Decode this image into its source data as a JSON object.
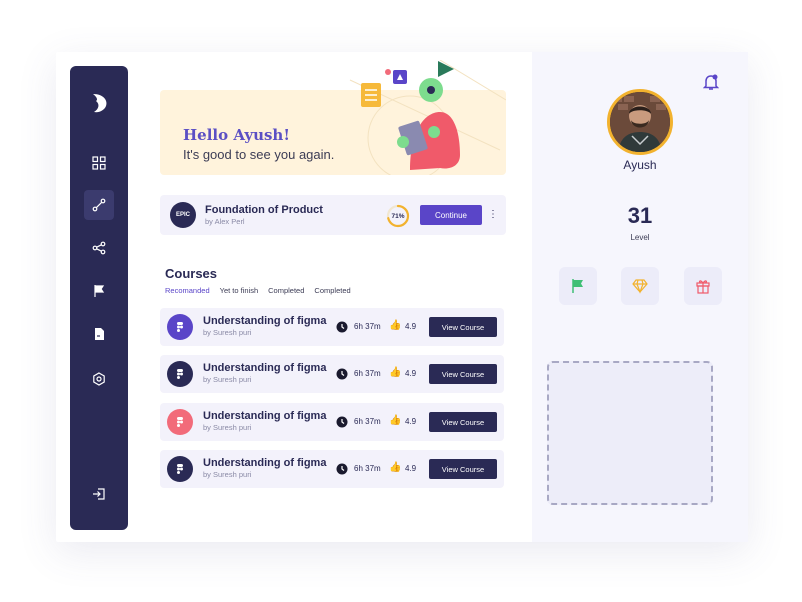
{
  "colors": {
    "sidebar": "#2a2a55",
    "accent": "#5a45c8",
    "banner": "#fff3dc",
    "progress": "#f2b22e"
  },
  "sidebar": {
    "items": [
      {
        "icon": "grid-icon"
      },
      {
        "icon": "route-icon",
        "active": true
      },
      {
        "icon": "share-icon"
      },
      {
        "icon": "flag-icon"
      },
      {
        "icon": "document-icon"
      },
      {
        "icon": "settings-hexagon-icon"
      },
      {
        "icon": "logout-icon"
      }
    ]
  },
  "banner": {
    "title": "Hello Ayush!",
    "subtitle": "It's good to see you again."
  },
  "current_course": {
    "logo_text": "EPIC",
    "title": "Foundation of Product",
    "author": "by Alex  Perl",
    "progress": 0.71,
    "progress_label": "71%",
    "continue_label": "Continue",
    "more_label": "⋮"
  },
  "courses": {
    "title": "Courses",
    "tabs": [
      "Recomanded",
      "Yet to finish",
      "Completed",
      "Completed"
    ],
    "items": [
      {
        "title": "Understanding of figma",
        "author": "by Suresh puri",
        "duration": "6h 37m",
        "rating": "4.9",
        "button": "View Course",
        "icon_color": "#5a45c8"
      },
      {
        "title": "Understanding of figma",
        "author": "by Suresh puri",
        "duration": "6h 37m",
        "rating": "4.9",
        "button": "View Course",
        "icon_color": "#2a2a55"
      },
      {
        "title": "Understanding of figma",
        "author": "by Suresh puri",
        "duration": "6h 37m",
        "rating": "4.9",
        "button": "View Course",
        "icon_color": "#f26b7a"
      },
      {
        "title": "Understanding of figma",
        "author": "by Suresh puri",
        "duration": "6h 37m",
        "rating": "4.9",
        "button": "View Course",
        "icon_color": "#2a2a55"
      }
    ]
  },
  "profile": {
    "name": "Ayush",
    "level": "31",
    "level_label": "Level",
    "badges": [
      "flag-badge-icon",
      "diamond-badge-icon",
      "gift-badge-icon"
    ]
  }
}
